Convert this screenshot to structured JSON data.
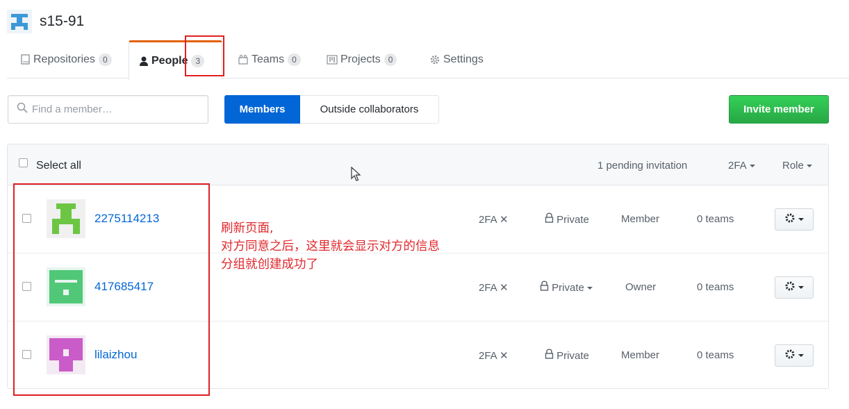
{
  "org": {
    "name": "s15-91"
  },
  "tabs": [
    {
      "label": "Repositories",
      "count": "0",
      "icon": "repo-icon"
    },
    {
      "label": "People",
      "count": "3",
      "icon": "person-icon"
    },
    {
      "label": "Teams",
      "count": "0",
      "icon": "team-icon"
    },
    {
      "label": "Projects",
      "count": "0",
      "icon": "project-icon"
    },
    {
      "label": "Settings",
      "count": "",
      "icon": "gear-icon"
    }
  ],
  "search": {
    "placeholder": "Find a member…",
    "value": ""
  },
  "filter": {
    "members_label": "Members",
    "outside_label": "Outside collaborators"
  },
  "invite_label": "Invite member",
  "table_header": {
    "select_all": "Select all",
    "pending": "1 pending invitation",
    "twofa": "2FA",
    "role": "Role"
  },
  "members": [
    {
      "username": "2275114213",
      "twofa": "2FA",
      "visibility": "Private",
      "role": "Member",
      "teams": "0 teams",
      "avatar_color": "#6cc644"
    },
    {
      "username": "417685417",
      "twofa": "2FA",
      "visibility": "Private",
      "role": "Owner",
      "teams": "0 teams",
      "avatar_color": "#50c878"
    },
    {
      "username": "lilaizhou",
      "twofa": "2FA",
      "visibility": "Private",
      "role": "Member",
      "teams": "0 teams",
      "avatar_color": "#c95cc8"
    }
  ],
  "annotation": {
    "line1": "刷新页面,",
    "line2": "对方同意之后，这里就会显示对方的信息",
    "line3": "分组就创建成功了"
  },
  "colors": {
    "accent": "#0366d6",
    "invite_green": "#28a745",
    "tab_underline": "#e36209",
    "annotation_red": "#e02020"
  }
}
